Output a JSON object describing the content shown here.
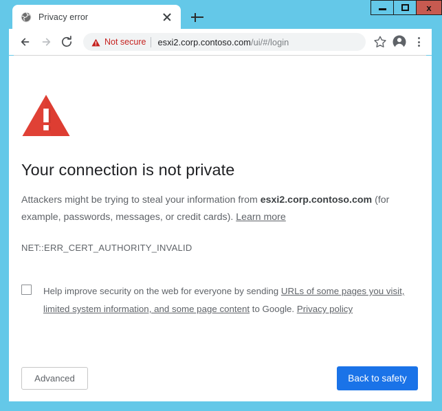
{
  "window": {
    "controls": {
      "minimize_label": "Minimize",
      "maximize_label": "Maximize",
      "close_label": "x"
    },
    "frame_color": "#64c8e8",
    "close_color": "#c75a50"
  },
  "tabstrip": {
    "tab": {
      "title": "Privacy error",
      "favicon": "globe-icon",
      "close_label": "Close tab"
    },
    "new_tab_label": "New tab"
  },
  "toolbar": {
    "back_label": "Back",
    "forward_label": "Forward",
    "reload_label": "Reload",
    "omnibox": {
      "security_icon": "warning-triangle-icon",
      "security_label": "Not secure",
      "url_host": "esxi2.corp.contoso.com",
      "url_path": "/ui/#/login",
      "full_url": "esxi2.corp.contoso.com/ui/#/login",
      "security_color": "#c5221f"
    },
    "bookmark_label": "Bookmark this page",
    "profile_label": "Profile",
    "menu_label": "Customize and control Google Chrome"
  },
  "page": {
    "icon": "red-warning-triangle-icon",
    "icon_color": "#e04136",
    "headline": "Your connection is not private",
    "paragraph": {
      "before_host": "Attackers might be trying to steal your information from ",
      "host": "esxi2.corp.contoso.com",
      "after_host": " (for example, passwords, messages, or credit cards). ",
      "learn_more": "Learn more"
    },
    "error_code": "NET::ERR_CERT_AUTHORITY_INVALID",
    "optin": {
      "checked": false,
      "text_before": "Help improve security on the web for everyone by sending ",
      "link_one": "URLs of some pages you visit, limited system information, and some page content",
      "text_middle": " to Google. ",
      "link_two": "Privacy policy"
    },
    "buttons": {
      "advanced": "Advanced",
      "back_to_safety": "Back to safety",
      "primary_color": "#1a73e8"
    }
  }
}
